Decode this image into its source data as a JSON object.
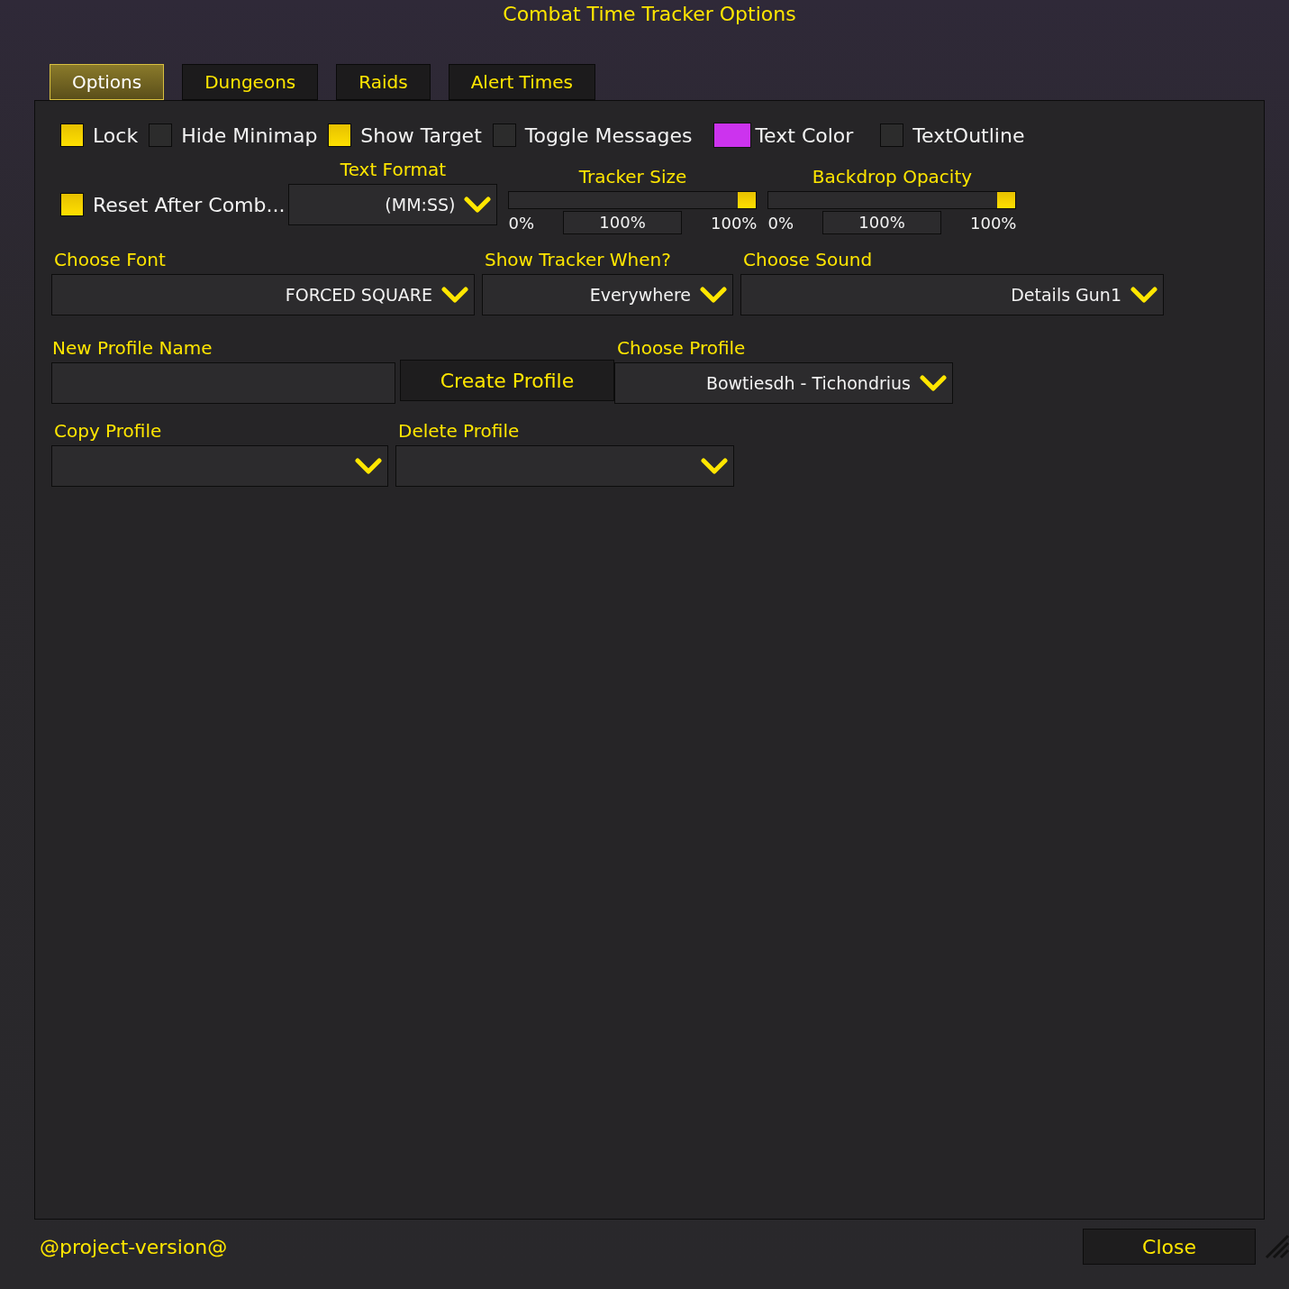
{
  "window": {
    "title": "Combat Time Tracker Options"
  },
  "tabs": [
    {
      "label": "Options",
      "selected": true
    },
    {
      "label": "Dungeons",
      "selected": false
    },
    {
      "label": "Raids",
      "selected": false
    },
    {
      "label": "Alert Times",
      "selected": false
    }
  ],
  "toggles": [
    {
      "kind": "checkbox",
      "label": "Lock",
      "checked": true
    },
    {
      "kind": "checkbox",
      "label": "Hide Minimap",
      "checked": false
    },
    {
      "kind": "checkbox",
      "label": "Show Target",
      "checked": true
    },
    {
      "kind": "checkbox",
      "label": "Toggle Messages",
      "checked": false
    },
    {
      "kind": "color",
      "label": "Text Color",
      "color": "#cc33ee"
    },
    {
      "kind": "checkbox",
      "label": "TextOutline",
      "checked": false
    }
  ],
  "reset_toggle": {
    "label": "Reset After Comb...",
    "checked": true
  },
  "text_format": {
    "label": "Text Format",
    "value": "(MM:SS)"
  },
  "sliders": [
    {
      "label": "Tracker Size",
      "level": 1,
      "min": "0%",
      "value": "100%",
      "max": "100%"
    },
    {
      "label": "Backdrop Opacity",
      "level": 1,
      "min": "0%",
      "value": "100%",
      "max": "100%"
    }
  ],
  "dropdowns": [
    {
      "label": "Choose Font",
      "value": "FORCED SQUARE"
    },
    {
      "label": "Show Tracker When?",
      "value": "Everywhere"
    },
    {
      "label": "Choose Sound",
      "value": "Details Gun1"
    }
  ],
  "new_profile": {
    "label": "New Profile Name",
    "button": "Create Profile"
  },
  "choose_profile": {
    "label": "Choose Profile",
    "value": "Bowtiesdh - Tichondrius"
  },
  "copy_profile": {
    "label": "Copy Profile"
  },
  "delete_profile": {
    "label": "Delete Profile"
  },
  "footer": {
    "version": "@project-version@",
    "close": "Close"
  }
}
